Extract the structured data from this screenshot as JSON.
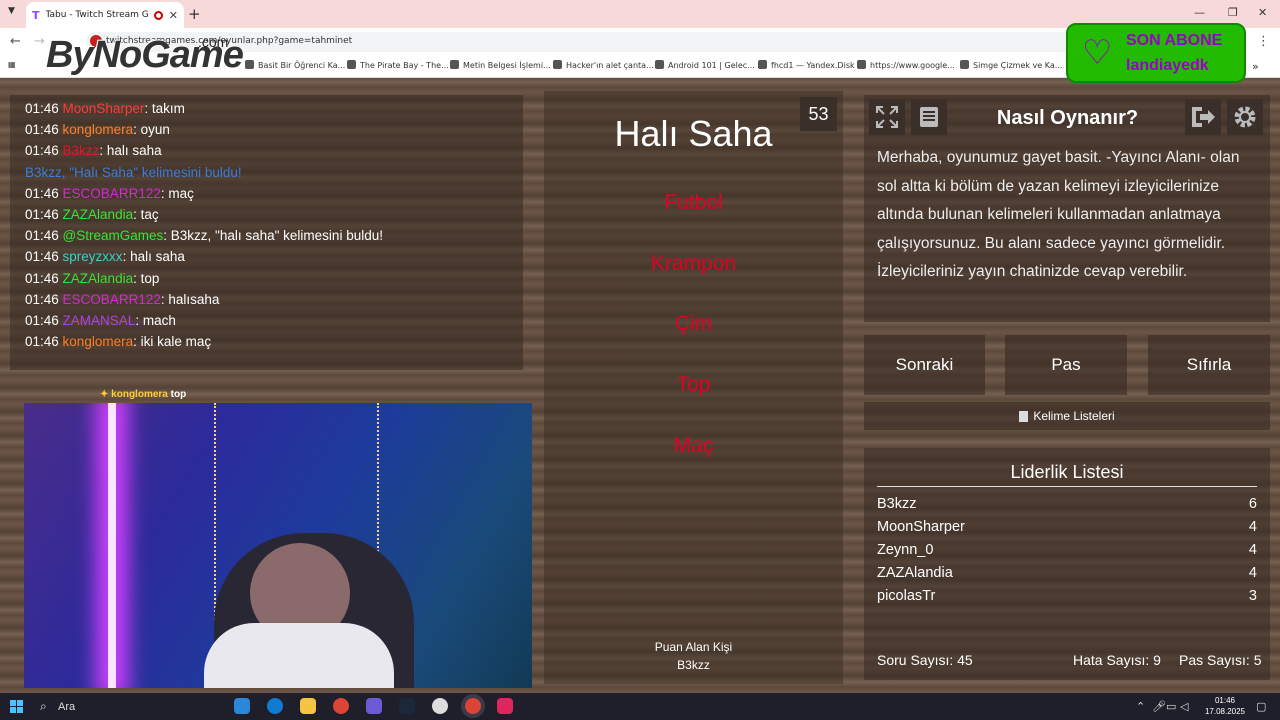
{
  "browser": {
    "tab_title": "Tabu - Twitch Stream Game",
    "url": "twitchstreamgames.com/oyunlar.php?game=tahminet",
    "bookmarks": [
      "Basit Bir Öğrenci Ka...",
      "The Pirate Bay - The...",
      "Metin Belgesi İşlemi...",
      "Hacker'ın alet çanta...",
      "Android 101 | Gelec...",
      "fhcd1 — Yandex.Disk",
      "https://www.google...",
      "Simge Çizmek ve Ka..."
    ]
  },
  "overlay": {
    "logo": "ByNoGame",
    "logo_suffix": ".com",
    "sub_title": "SON ABONE",
    "sub_name": "landiayedk",
    "cam_label_user": "konglomera",
    "cam_label_msg": "top"
  },
  "chat": [
    {
      "time": "01:46",
      "user": "MoonSharper",
      "msg": ": takım",
      "color": "#ff3b3b"
    },
    {
      "time": "01:46",
      "user": "konglomera",
      "msg": ": oyun",
      "color": "#ff7f27"
    },
    {
      "time": "01:46",
      "user": "B3kzz",
      "msg": ": halı saha",
      "color": "#e0182d"
    },
    {
      "time": "",
      "user": "B3kzz, \"Halı Saha\" kelimesini buldu!",
      "msg": "",
      "color": "#3c7dd9"
    },
    {
      "time": "01:46",
      "user": "ESCOBARR122",
      "msg": ": maç",
      "color": "#d42ad4"
    },
    {
      "time": "01:46",
      "user": "ZAZAlandia",
      "msg": ": taç",
      "color": "#33e633"
    },
    {
      "time": "01:46",
      "user": "@StreamGames",
      "msg": ": B3kzz, \"halı saha\" kelimesini buldu!",
      "color": "#33e633"
    },
    {
      "time": "01:46",
      "user": "spreyzxxx",
      "msg": ": halı saha",
      "color": "#3ad1c9"
    },
    {
      "time": "01:46",
      "user": "ZAZAlandia",
      "msg": ": top",
      "color": "#33e633"
    },
    {
      "time": "01:46",
      "user": "ESCOBARR122",
      "msg": ": halısaha",
      "color": "#d42ad4"
    },
    {
      "time": "01:46",
      "user": "ZAMANSAL",
      "msg": ": mach",
      "color": "#b040e8"
    },
    {
      "time": "01:46",
      "user": "konglomera",
      "msg": ": iki kale maç",
      "color": "#ff7f27"
    }
  ],
  "game": {
    "timer": "53",
    "word": "Halı Saha",
    "forbidden": [
      "Futbol",
      "Krampon",
      "Çim",
      "Top",
      "Maç"
    ],
    "scorer_title": "Puan Alan Kişi",
    "scorer_name": "B3kzz"
  },
  "howto": {
    "title": "Nasıl Oynanır?",
    "text": "Merhaba, oyunumuz gayet basit. -Yayıncı Alanı- olan sol altta ki bölüm de yazan kelimeyi izleyicilerinize altında bulunan kelimeleri kullanmadan anlatmaya çalışıyorsunuz. Bu alanı sadece yayıncı görmelidir. İzleyicileriniz yayın chatinizde cevap verebilir."
  },
  "controls": {
    "next": "Sonraki",
    "pass": "Pas",
    "reset": "Sıfırla",
    "word_lists": "Kelime Listeleri"
  },
  "leaderboard": {
    "title": "Liderlik Listesi",
    "rows": [
      {
        "name": "B3kzz",
        "score": "6"
      },
      {
        "name": "MoonSharper",
        "score": "4"
      },
      {
        "name": "Zeynn_0",
        "score": "4"
      },
      {
        "name": "ZAZAlandia",
        "score": "4"
      },
      {
        "name": "picolasTr",
        "score": "3"
      }
    ],
    "questions": "Soru Sayısı: 45",
    "errors": "Hata Sayısı: 9",
    "passes": "Pas Sayısı: 5"
  },
  "taskbar": {
    "search": "Ara",
    "time": "01:46",
    "date": "17.08.2025"
  }
}
